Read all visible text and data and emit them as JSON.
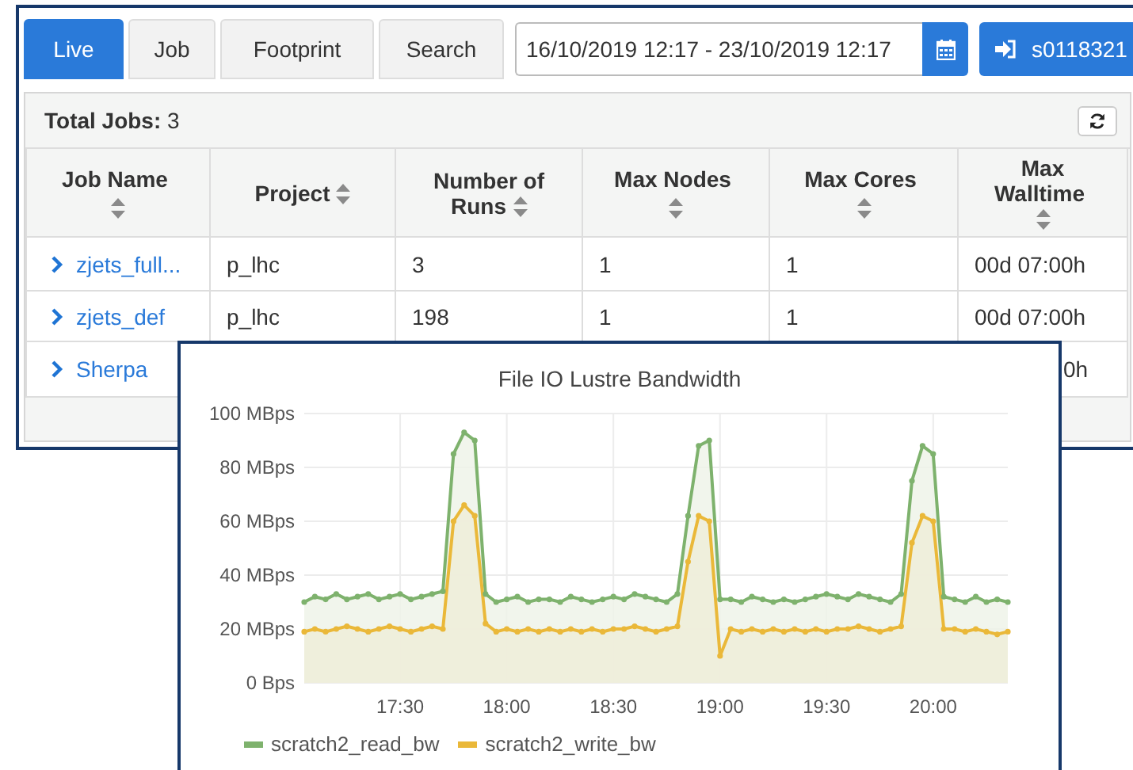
{
  "tabs": [
    {
      "label": "Live",
      "selected": true
    },
    {
      "label": "Job",
      "selected": false
    },
    {
      "label": "Footprint",
      "selected": false
    },
    {
      "label": "Search",
      "selected": false
    }
  ],
  "date_range": {
    "value": "16/10/2019 12:17 - 23/10/2019 12:17"
  },
  "user_button": {
    "label": "s0118321"
  },
  "jobs_panel": {
    "total": "**Total Jobs:** 3",
    "columns": [
      "Job Name",
      "Project",
      "Number of Runs",
      "Max Nodes",
      "Max Cores",
      "Max Walltime"
    ],
    "rows": [
      {
        "job_name": "zjets_full...",
        "expanded": false,
        "project": "p_lhc",
        "runs": "3",
        "max_nodes": "1",
        "max_cores": "1",
        "max_walltime": "00d 07:00h"
      },
      {
        "job_name": "zjets_def",
        "expanded": false,
        "project": "p_lhc",
        "runs": "198",
        "max_nodes": "1",
        "max_cores": "1",
        "max_walltime": "00d 07:00h"
      },
      {
        "job_name": "Sherpa",
        "expanded": false,
        "max_walltime": "0h"
      }
    ]
  },
  "popup": {
    "chart_data": {
      "type": "area",
      "grid": true,
      "title": "File IO Lustre Bandwidth",
      "categories": [
        null,
        null,
        null,
        null,
        null,
        null,
        null,
        null,
        null,
        "17:30",
        null,
        null,
        null,
        null,
        null,
        null,
        null,
        null,
        null,
        "18:00",
        null,
        null,
        null,
        null,
        null,
        null,
        null,
        null,
        null,
        "18:30",
        null,
        null,
        null,
        null,
        null,
        null,
        null,
        null,
        null,
        "19:00",
        null,
        null,
        null,
        null,
        null,
        null,
        null,
        null,
        null,
        "19:30",
        null,
        null,
        null,
        null,
        null,
        null,
        null,
        null,
        null,
        "20:00",
        null,
        null,
        null,
        null,
        null,
        null,
        null
      ],
      "series": [
        {
          "name": "scratch2_read_bw",
          "color": "#7eb26d",
          "marker": "circle",
          "values": [
            30,
            32,
            31,
            33,
            31,
            32,
            33,
            31,
            32,
            33,
            31,
            32,
            33,
            34,
            85,
            93,
            90,
            33,
            30,
            31,
            32,
            30,
            31,
            31,
            30,
            32,
            31,
            30,
            31,
            32,
            31,
            33,
            32,
            31,
            30,
            33,
            62,
            88,
            90,
            31,
            31,
            30,
            32,
            31,
            30,
            31,
            30,
            31,
            32,
            33,
            32,
            31,
            33,
            32,
            31,
            30,
            33,
            75,
            88,
            85,
            32,
            31,
            30,
            32,
            30,
            31,
            30
          ]
        },
        {
          "name": "scratch2_write_bw",
          "color": "#eab839",
          "marker": "circle",
          "values": [
            19,
            20,
            19,
            20,
            21,
            20,
            19,
            20,
            21,
            20,
            19,
            20,
            21,
            20,
            60,
            66,
            62,
            22,
            19,
            20,
            19,
            20,
            19,
            20,
            19,
            20,
            19,
            20,
            19,
            20,
            20,
            21,
            20,
            19,
            20,
            21,
            45,
            62,
            60,
            10,
            20,
            19,
            20,
            19,
            20,
            19,
            20,
            19,
            20,
            19,
            20,
            20,
            21,
            20,
            19,
            20,
            21,
            52,
            62,
            60,
            20,
            20,
            19,
            20,
            19,
            18,
            19
          ]
        }
      ],
      "ylim": [
        0,
        100
      ],
      "yticks": [
        {
          "value": 0,
          "label": "0 Bps"
        },
        {
          "value": 20,
          "label": "20 MBps"
        },
        {
          "value": 40,
          "label": "40 MBps"
        },
        {
          "value": 60,
          "label": "60 MBps"
        },
        {
          "value": 80,
          "label": "80 MBps"
        },
        {
          "value": 100,
          "label": "100 MBps"
        }
      ]
    }
  }
}
